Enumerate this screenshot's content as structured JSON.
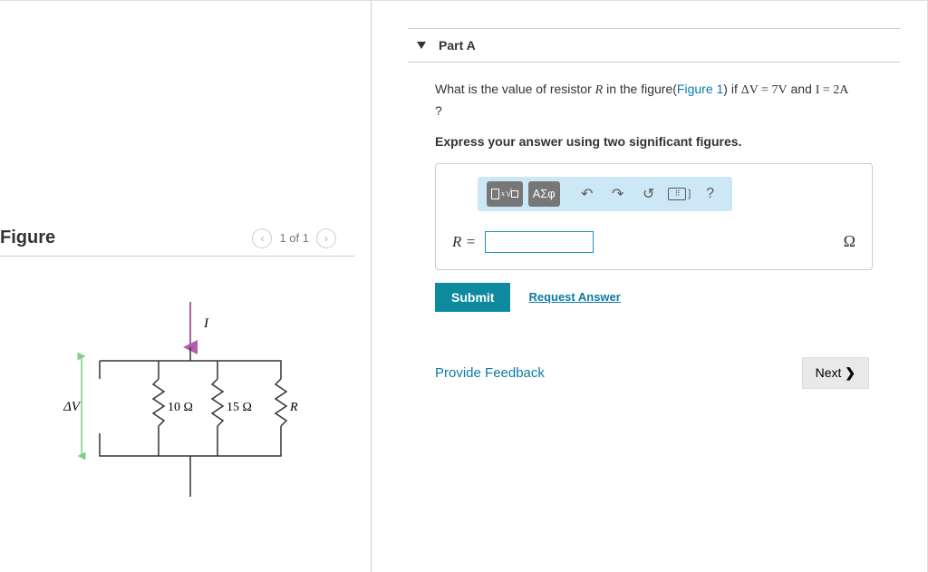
{
  "figure": {
    "title": "Figure",
    "nav": "1 of 1"
  },
  "circuit": {
    "dv_label": "ΔV",
    "i_label": "I",
    "r1": "10 Ω",
    "r2": "15 Ω",
    "r3": "R"
  },
  "partA": {
    "header": "Part A",
    "question_prefix": "What is the value of resistor ",
    "question_var": "R",
    "question_mid": " in the figure(",
    "figure_link": "Figure 1",
    "question_mid2": ") if ",
    "cond1": "ΔV = 7V",
    "cond_and": " and ",
    "cond2": "I = 2A",
    "question_end": " ?",
    "instruction": "Express your answer using two significant figures.",
    "symbols_label": "ΑΣφ",
    "r_equals": "R =",
    "unit": "Ω",
    "help_q": "?",
    "bracket": "]"
  },
  "actions": {
    "submit": "Submit",
    "request": "Request Answer",
    "feedback": "Provide Feedback",
    "next": "Next"
  }
}
